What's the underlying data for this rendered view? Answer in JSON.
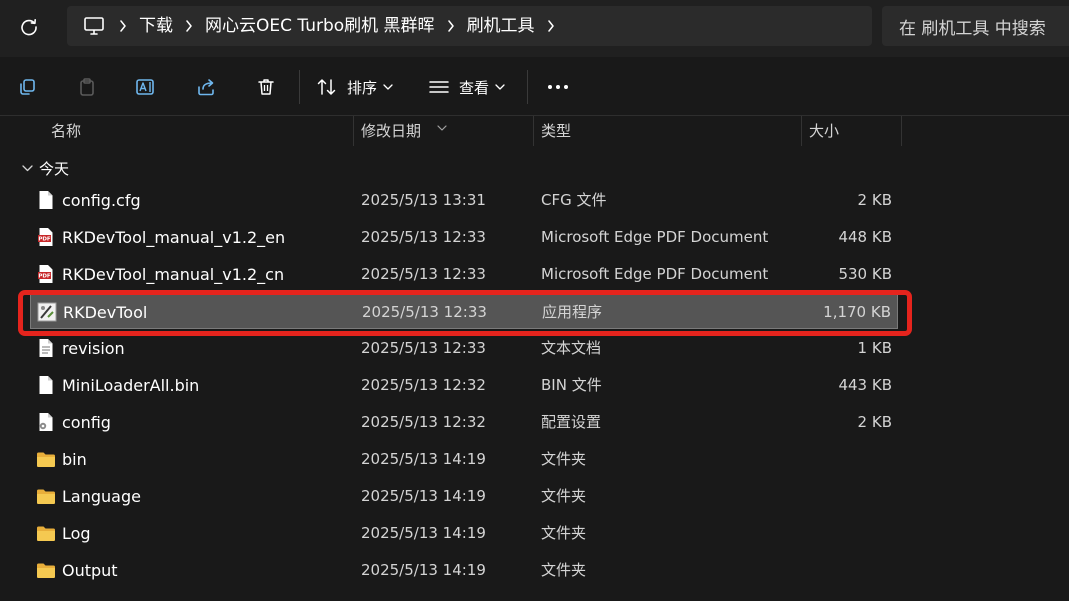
{
  "address": {
    "breadcrumbs": [
      "下载",
      "网心云OEC Turbo刷机 黑群晖",
      "刷机工具"
    ]
  },
  "search": {
    "placeholder": "在 刷机工具 中搜索"
  },
  "toolbar": {
    "sort_label": "排序",
    "view_label": "查看"
  },
  "columns": {
    "name": "名称",
    "date": "修改日期",
    "type": "类型",
    "size": "大小"
  },
  "group": {
    "label": "今天"
  },
  "files": [
    {
      "name": "config.cfg",
      "date": "2025/5/13 13:31",
      "type": "CFG 文件",
      "size": "2 KB",
      "icon": "file-icon"
    },
    {
      "name": "RKDevTool_manual_v1.2_en",
      "date": "2025/5/13 12:33",
      "type": "Microsoft Edge PDF Document",
      "size": "448 KB",
      "icon": "pdf-icon"
    },
    {
      "name": "RKDevTool_manual_v1.2_cn",
      "date": "2025/5/13 12:33",
      "type": "Microsoft Edge PDF Document",
      "size": "530 KB",
      "icon": "pdf-icon"
    },
    {
      "name": "RKDevTool",
      "date": "2025/5/13 12:33",
      "type": "应用程序",
      "size": "1,170 KB",
      "icon": "app-icon",
      "selected": true
    },
    {
      "name": "revision",
      "date": "2025/5/13 12:33",
      "type": "文本文档",
      "size": "1 KB",
      "icon": "text-file-icon"
    },
    {
      "name": "MiniLoaderAll.bin",
      "date": "2025/5/13 12:32",
      "type": "BIN 文件",
      "size": "443 KB",
      "icon": "file-icon"
    },
    {
      "name": "config",
      "date": "2025/5/13 12:32",
      "type": "配置设置",
      "size": "2 KB",
      "icon": "settings-file-icon"
    },
    {
      "name": "bin",
      "date": "2025/5/13 14:19",
      "type": "文件夹",
      "size": "",
      "icon": "folder-icon"
    },
    {
      "name": "Language",
      "date": "2025/5/13 14:19",
      "type": "文件夹",
      "size": "",
      "icon": "folder-icon"
    },
    {
      "name": "Log",
      "date": "2025/5/13 14:19",
      "type": "文件夹",
      "size": "",
      "icon": "folder-icon"
    },
    {
      "name": "Output",
      "date": "2025/5/13 14:19",
      "type": "文件夹",
      "size": "",
      "icon": "folder-icon"
    }
  ],
  "colors": {
    "highlight": "#e5241d",
    "folder": "#f2c14e",
    "pdf": "#c8282a"
  }
}
